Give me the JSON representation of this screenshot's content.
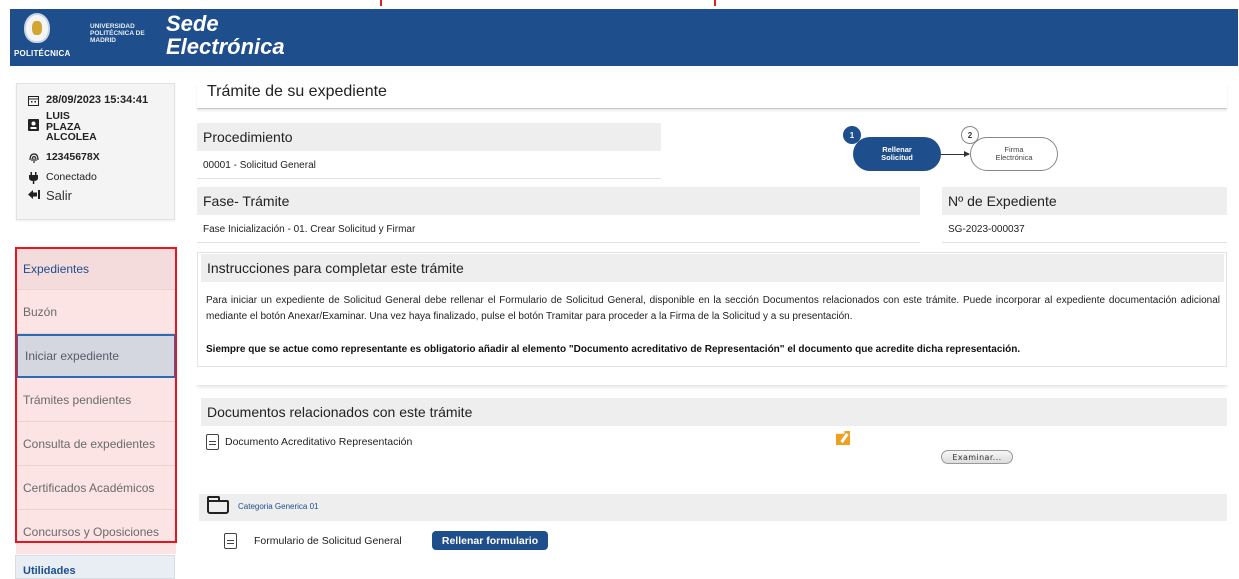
{
  "header": {
    "logo_short": "POLITÉCNICA",
    "logo_university": "UNIVERSIDAD POLITÉCNICA DE MADRID",
    "title_line1": "Sede",
    "title_line2": "Electrónica",
    "brand_color": "#1f4e8c"
  },
  "user": {
    "datetime": "28/09/2023 15:34:41",
    "name_line1": "LUIS",
    "name_line2": "PLAZA",
    "name_line3": "ALCOLEA",
    "document_id": "12345678X",
    "status": "Conectado",
    "logout_label": "Salir",
    "icons": [
      "calendar-icon",
      "id-card-icon",
      "fingerprint-icon",
      "plug-icon",
      "logout-icon"
    ]
  },
  "menu": {
    "section_label": "Expedientes",
    "items": [
      {
        "label": "Buzón"
      },
      {
        "label": "Iniciar expediente"
      },
      {
        "label": "Trámites pendientes"
      },
      {
        "label": "Consulta de expedientes"
      },
      {
        "label": "Certificados Académicos"
      },
      {
        "label": "Concursos y Oposiciones"
      }
    ],
    "selected": "Iniciar expediente",
    "utilities_label": "Utilidades",
    "highlight_color": "#e8141e"
  },
  "main": {
    "title": "Trámite de su expediente",
    "procedure_label": "Procedimiento",
    "procedure_value": "00001 - Solicitud General",
    "phase_label": "Fase- Trámite",
    "phase_value": "Fase Inicialización - 01. Crear Solicitud y Firmar",
    "file_number_label": "Nº de Expediente",
    "file_number_value": "SG-2023-000037",
    "steps": [
      {
        "number": "1",
        "line1": "Rellenar",
        "line2": "Solicitud",
        "active": true
      },
      {
        "number": "2",
        "line1": "Firma",
        "line2": "Electrónica",
        "active": false
      }
    ],
    "instructions_title": "Instrucciones para completar este trámite",
    "instructions_text": "Para iniciar un expediente de Solicitud General debe rellenar el Formulario de Solicitud General, disponible en la sección Documentos relacionados con este trámite. Puede incorporar al expediente documentación adicional mediante el botón Anexar/Examinar. Una vez haya finalizado, pulse el botón Tramitar para proceder a la Firma de la Solicitud y a su presentación.",
    "instructions_bold": "Siempre que se actue como representante es obligatorio añadir al elemento \"Documento acreditativo de Representación\" el documento que acredite dicha representación.",
    "documents_title": "Documentos relacionados con este trámite",
    "doc1_label": "Documento Acreditativo Representación",
    "browse_label": "Examinar...",
    "category_label": "Categoria Generica 01",
    "doc2_label": "Formulario de Solicitud General",
    "fill_form_label": "Rellenar formulario"
  }
}
